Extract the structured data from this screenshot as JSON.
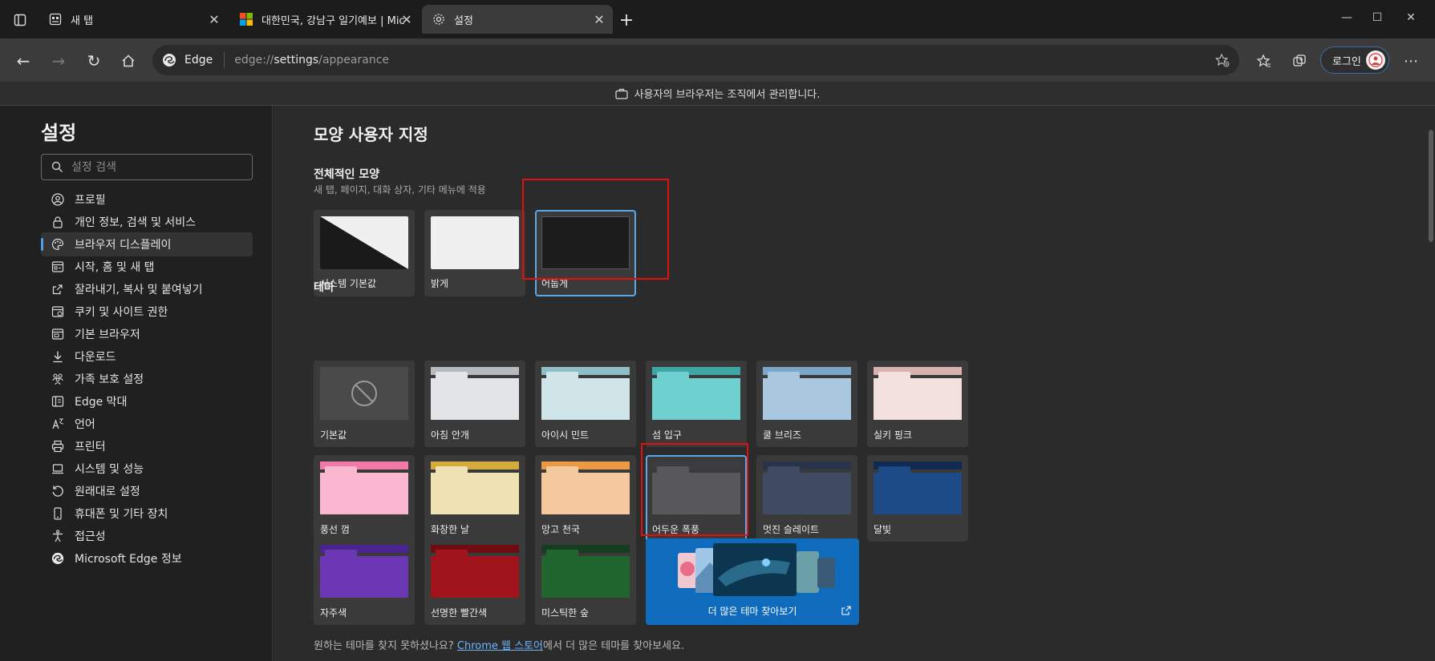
{
  "tabs": [
    {
      "title": "새 탭",
      "icon": "new-tab-page-icon"
    },
    {
      "title": "대한민국, 강남구 일기예보 | Mic",
      "icon": "microsoft-logo-icon"
    },
    {
      "title": "설정",
      "icon": "gear-icon"
    }
  ],
  "address": {
    "site_label": "Edge",
    "url_prefix": "edge://",
    "url_host": "settings",
    "url_path": "/appearance"
  },
  "toolbar": {
    "login_label": "로그인"
  },
  "infobar": {
    "text": "사용자의 브라우저는 조직에서 관리합니다."
  },
  "sidebar": {
    "title": "설정",
    "search_placeholder": "설정 검색",
    "items": [
      {
        "label": "프로필",
        "icon": "profile-icon"
      },
      {
        "label": "개인 정보, 검색 및 서비스",
        "icon": "lock-icon"
      },
      {
        "label": "브라우저 디스플레이",
        "icon": "palette-icon"
      },
      {
        "label": "시작, 홈 및 새 탭",
        "icon": "home-tab-icon"
      },
      {
        "label": "잘라내기, 복사 및 붙여넣기",
        "icon": "share-icon"
      },
      {
        "label": "쿠키 및 사이트 권한",
        "icon": "cookie-icon"
      },
      {
        "label": "기본 브라우저",
        "icon": "browser-icon"
      },
      {
        "label": "다운로드",
        "icon": "download-icon"
      },
      {
        "label": "가족 보호 설정",
        "icon": "family-icon"
      },
      {
        "label": "Edge 막대",
        "icon": "edge-bar-icon"
      },
      {
        "label": "언어",
        "icon": "language-icon"
      },
      {
        "label": "프린터",
        "icon": "printer-icon"
      },
      {
        "label": "시스템 및 성능",
        "icon": "laptop-icon"
      },
      {
        "label": "원래대로 설정",
        "icon": "reset-icon"
      },
      {
        "label": "휴대폰 및 기타 장치",
        "icon": "phone-icon"
      },
      {
        "label": "접근성",
        "icon": "accessibility-icon"
      },
      {
        "label": "Microsoft Edge 정보",
        "icon": "edge-logo-icon"
      }
    ]
  },
  "main": {
    "page_title": "모양 사용자 지정",
    "overall": {
      "title": "전체적인 모양",
      "subtitle": "새 탭, 페이지, 대화 상자, 기타 메뉴에 적용",
      "options": [
        {
          "label": "시스템 기본값"
        },
        {
          "label": "밝게"
        },
        {
          "label": "어둡게"
        }
      ]
    },
    "themes": {
      "title": "테마",
      "items": [
        {
          "label": "기본값",
          "top": "#4a4a4a",
          "tab": "#4a4a4a",
          "body": "#4a4a4a"
        },
        {
          "label": "아침 안개",
          "top": "#b6b9bf",
          "tab": "#e3e4e8",
          "body": "#e3e4e8"
        },
        {
          "label": "아이시 민트",
          "top": "#8fbfc6",
          "tab": "#cfe5e8",
          "body": "#cfe5e8"
        },
        {
          "label": "섬 입구",
          "top": "#3fa6a6",
          "tab": "#6fd1cf",
          "body": "#6fd1cf"
        },
        {
          "label": "쿨 브리즈",
          "top": "#7aa6c9",
          "tab": "#a9c7df",
          "body": "#a9c7df"
        },
        {
          "label": "실키 핑크",
          "top": "#d9b3b0",
          "tab": "#f3e1e0",
          "body": "#f3e1e0"
        },
        {
          "label": "풍선 껌",
          "top": "#f17aa9",
          "tab": "#fbb7d0",
          "body": "#fbb7d0"
        },
        {
          "label": "화창한 날",
          "top": "#d4ab3c",
          "tab": "#f0e1b3",
          "body": "#f0e1b3"
        },
        {
          "label": "망고 천국",
          "top": "#ea9945",
          "tab": "#f4c99e",
          "body": "#f4c99e"
        },
        {
          "label": "어두운 폭풍",
          "top": "#3c3c40",
          "tab": "#57575c",
          "body": "#57575c"
        },
        {
          "label": "멋진 슬레이트",
          "top": "#29344a",
          "tab": "#3e4b63",
          "body": "#3e4b63"
        },
        {
          "label": "달빛",
          "top": "#0f2b52",
          "tab": "#1b4a86",
          "body": "#1b4a86"
        },
        {
          "label": "자주색",
          "top": "#4a2592",
          "tab": "#6b37b5",
          "body": "#6b37b5"
        },
        {
          "label": "선명한 빨간색",
          "top": "#6e0c12",
          "tab": "#a0141c",
          "body": "#a0141c"
        },
        {
          "label": "미스틱한 숲",
          "top": "#163d1f",
          "tab": "#22662f",
          "body": "#22662f"
        }
      ],
      "more_label": "더 많은 테마 찾아보기"
    },
    "footer": {
      "before": "원하는 테마를 찾지 못하셨나요?",
      "link": "Chrome 웹 스토어",
      "after": "에서 더 많은 테마를 찾아보세요."
    }
  },
  "colors": {
    "accent": "#5aa8e6",
    "highlight_box": "#e01010",
    "more_themes_bg": "#0f6cbd"
  }
}
